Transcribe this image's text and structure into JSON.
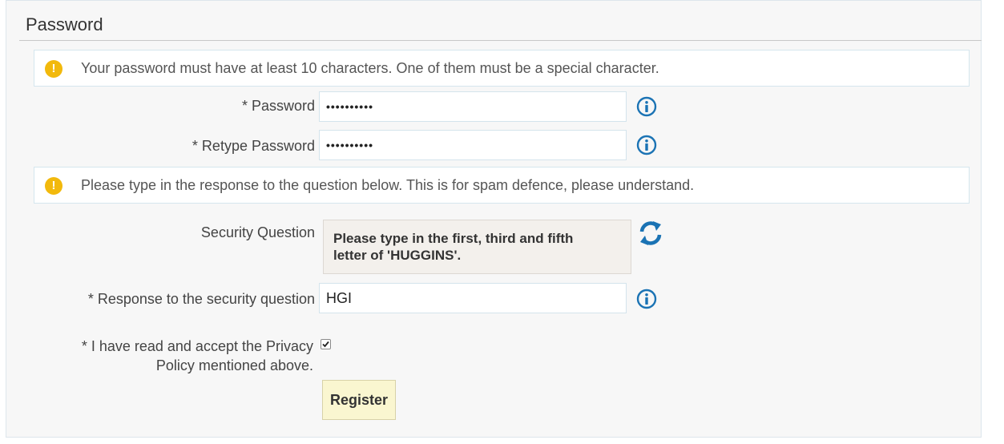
{
  "section": {
    "title": "Password"
  },
  "notices": {
    "password_rule": "Your password must have at least 10 characters. One of them must be a special character.",
    "spam_notice": "Please type in the response to the question below. This is for spam defence, please understand."
  },
  "fields": {
    "password": {
      "label": "* Password",
      "value": "••••••••••"
    },
    "retype": {
      "label": "* Retype Password",
      "value": "••••••••••"
    },
    "security_question": {
      "label": "Security Question",
      "text_line1": "Please type in the first, third and fifth",
      "text_line2": "letter of 'HUGGINS'."
    },
    "response": {
      "label": "* Response to the security question",
      "value": "HGI"
    },
    "privacy": {
      "label_line1": "* I have read and accept the Privacy",
      "label_line2": "Policy mentioned above.",
      "checked": true
    }
  },
  "actions": {
    "register_label": "Register"
  },
  "colors": {
    "notice_icon": "#f2b90c",
    "info_icon": "#1b73b4",
    "register_bg": "#faf6d0"
  },
  "icons": {
    "notice": "warning-info-icon",
    "field_info": "info-circle-icon",
    "refresh": "refresh-icon",
    "checkbox": "check-icon"
  }
}
